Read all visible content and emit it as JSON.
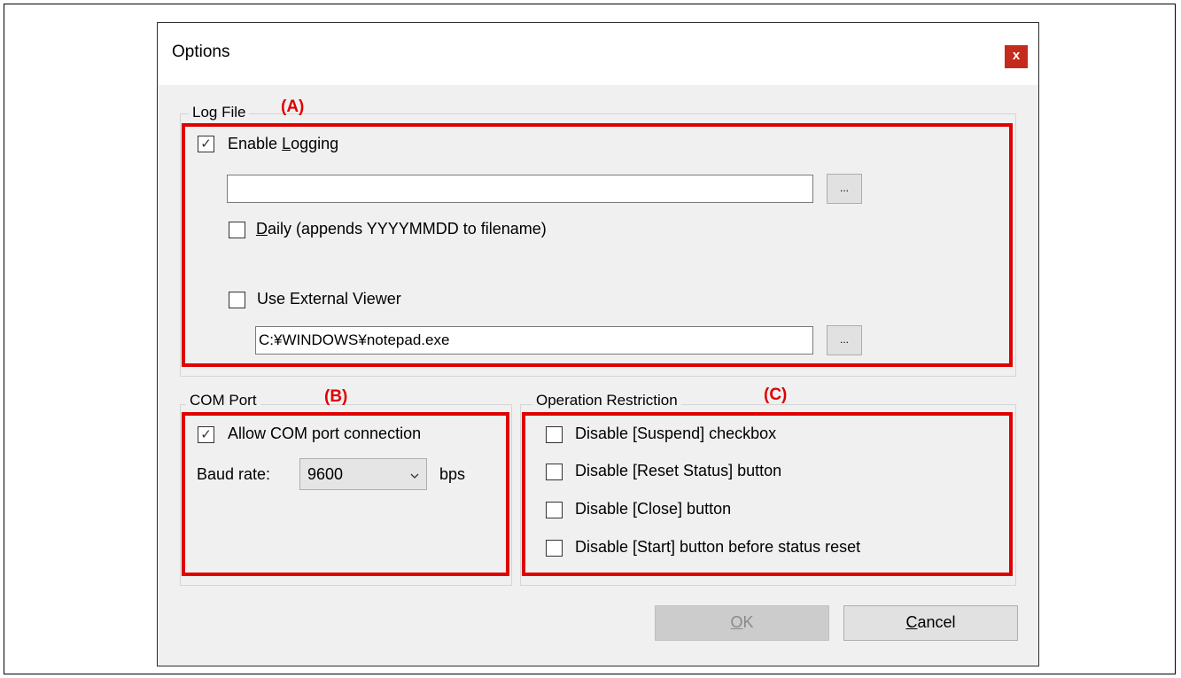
{
  "dialog": {
    "title": "Options",
    "close_label": "x"
  },
  "markers": {
    "a": "(A)",
    "b": "(B)",
    "c": "(C)"
  },
  "log_file": {
    "legend": "Log File",
    "enable_logging": {
      "pre": "Enable ",
      "key": "L",
      "post": "ogging",
      "checked": true
    },
    "log_path": {
      "value": "",
      "placeholder": ""
    },
    "browse_label": "...",
    "daily": {
      "key": "D",
      "post": "aily (appends YYYYMMDD to filename)",
      "checked": false
    },
    "external_viewer": {
      "label": "Use External Viewer",
      "checked": false
    },
    "viewer_path": {
      "value": "C:¥WINDOWS¥notepad.exe"
    }
  },
  "com_port": {
    "legend": "COM Port",
    "allow": {
      "label": "Allow COM port connection",
      "checked": true
    },
    "baud_label": "Baud rate:",
    "baud_value": "9600",
    "baud_unit": "bps"
  },
  "operation_restriction": {
    "legend": "Operation Restriction",
    "items": [
      {
        "label": "Disable [Suspend] checkbox",
        "checked": false
      },
      {
        "label": "Disable [Reset Status] button",
        "checked": false
      },
      {
        "label": "Disable [Close] button",
        "checked": false
      },
      {
        "label": "Disable [Start] button before status reset",
        "checked": false
      }
    ]
  },
  "buttons": {
    "ok": {
      "key": "O",
      "post": "K",
      "enabled": false
    },
    "cancel": {
      "key": "C",
      "post": "ancel"
    }
  },
  "check_glyph": "✓",
  "colors": {
    "annotation_red": "#e00000",
    "close_red": "#c42b1c"
  }
}
